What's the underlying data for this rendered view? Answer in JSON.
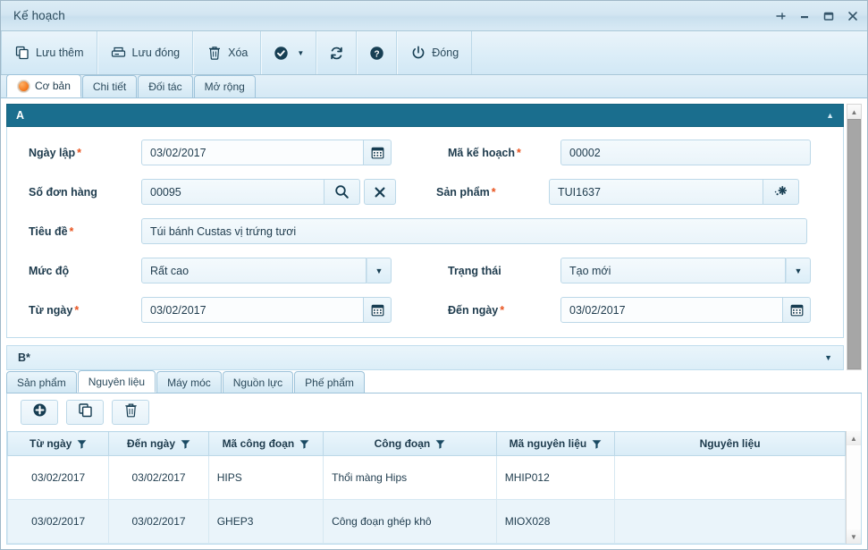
{
  "window": {
    "title": "Kế hoạch",
    "controls": [
      {
        "name": "pin-icon",
        "label": "Pin"
      },
      {
        "name": "minimize-icon",
        "label": "Minimize"
      },
      {
        "name": "maximize-icon",
        "label": "Maximize"
      },
      {
        "name": "close-icon",
        "label": "Close"
      }
    ]
  },
  "toolbar": {
    "buttons": [
      {
        "name": "save-add-button",
        "label": "Lưu thêm",
        "icon": "copy-icon"
      },
      {
        "name": "save-close-button",
        "label": "Lưu đóng",
        "icon": "save-icon"
      },
      {
        "name": "delete-button",
        "label": "Xóa",
        "icon": "trash-icon"
      },
      {
        "name": "approve-button",
        "label": "",
        "icon": "check-circle-icon",
        "caret": "▼"
      },
      {
        "name": "refresh-button",
        "label": "",
        "icon": "refresh-icon"
      },
      {
        "name": "help-button",
        "label": "",
        "icon": "help-circle-icon"
      },
      {
        "name": "close-form-button",
        "label": "Đóng",
        "icon": "power-icon"
      }
    ]
  },
  "tabs": [
    {
      "label": "Cơ bản",
      "active": true
    },
    {
      "label": "Chi tiết",
      "active": false
    },
    {
      "label": "Đối tác",
      "active": false
    },
    {
      "label": "Mở rộng",
      "active": false
    }
  ],
  "sections": {
    "a": {
      "title": "A",
      "arrow": "▲"
    },
    "b": {
      "title": "B*",
      "arrow": "▼"
    }
  },
  "form": {
    "ngay_lap": {
      "label": "Ngày lập",
      "required": "*",
      "value": "03/02/2017"
    },
    "ma_ke_hoach": {
      "label": "Mã kế hoạch",
      "required": "*",
      "value": "00002"
    },
    "so_don_hang": {
      "label": "Số đơn hàng",
      "required": "",
      "value": "00095"
    },
    "san_pham": {
      "label": "Sản phẩm",
      "required": "*",
      "value": "TUI1637"
    },
    "tieu_de": {
      "label": "Tiêu đề",
      "required": "*",
      "value": "Túi bánh Custas vị trứng tươi"
    },
    "muc_do": {
      "label": "Mức độ",
      "required": "",
      "value": "Rất cao"
    },
    "trang_thai": {
      "label": "Trạng thái",
      "required": "",
      "value": "Tạo mới"
    },
    "tu_ngay": {
      "label": "Từ ngày",
      "required": "*",
      "value": "03/02/2017"
    },
    "den_ngay": {
      "label": "Đến ngày",
      "required": "*",
      "value": "03/02/2017"
    }
  },
  "subtabs": [
    {
      "label": "Sản phẩm",
      "active": false
    },
    {
      "label": "Nguyên liệu",
      "active": true
    },
    {
      "label": "Máy móc",
      "active": false
    },
    {
      "label": "Nguồn lực",
      "active": false
    },
    {
      "label": "Phế phẩm",
      "active": false
    }
  ],
  "grid_tools": [
    {
      "name": "add-row-button",
      "icon": "plus-circle-icon"
    },
    {
      "name": "copy-row-button",
      "icon": "copy-icon"
    },
    {
      "name": "delete-row-button",
      "icon": "trash-icon"
    }
  ],
  "grid": {
    "columns": [
      {
        "label": "Từ ngày",
        "filter": true
      },
      {
        "label": "Đến ngày",
        "filter": true
      },
      {
        "label": "Mã công đoạn",
        "filter": true
      },
      {
        "label": "Công đoạn",
        "filter": true
      },
      {
        "label": "Mã nguyên liệu",
        "filter": true
      },
      {
        "label": "Nguyên liệu",
        "filter": false
      }
    ],
    "rows": [
      [
        "03/02/2017",
        "03/02/2017",
        "HIPS",
        "Thổi màng Hips",
        "MHIP012",
        ""
      ],
      [
        "03/02/2017",
        "03/02/2017",
        "GHEP3",
        "Công đoạn ghép khô",
        "MIOX028",
        ""
      ]
    ]
  },
  "colors": {
    "section_header": "#1a6e8e",
    "accent_orange": "#f47a1f",
    "required_red": "#e8531f",
    "text_dark": "#1e3b4d"
  }
}
